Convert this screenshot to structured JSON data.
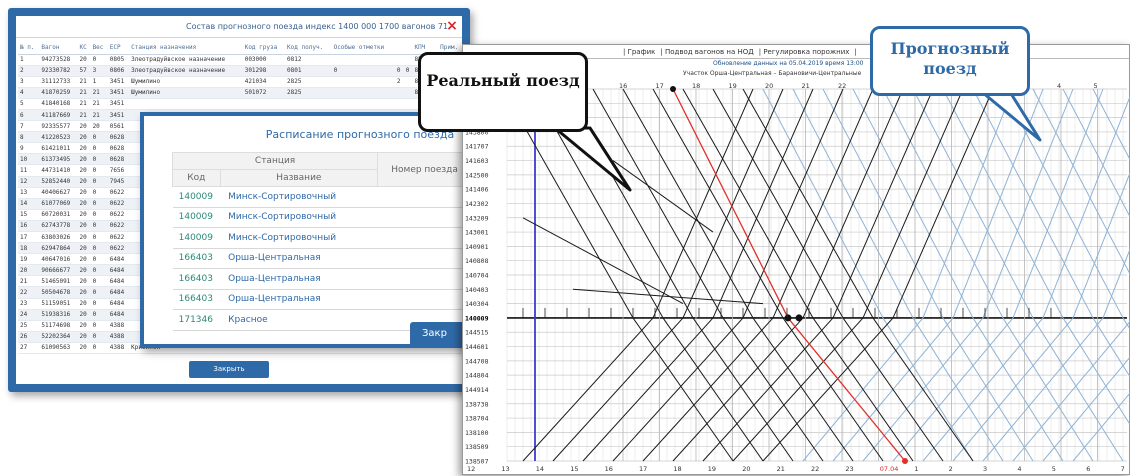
{
  "consist_window": {
    "title": "Состав прогнозного поезда индекс 1400 000 1700 вагонов 71",
    "close_label": "×",
    "columns": [
      "№ п.",
      "Вагон",
      "КС",
      "Вес",
      "ЕСР",
      "Станция назначения",
      "Код груза",
      "Код получ.",
      "Особые отметки",
      "",
      "",
      "КПЧ",
      "Прим."
    ],
    "rows": [
      [
        "1",
        "94273528",
        "20",
        "0",
        "0805",
        "Злеотрадуйвское назначение",
        "003000",
        "0812",
        "",
        "",
        "",
        "85/00",
        ""
      ],
      [
        "2",
        "92330782",
        "57",
        "3",
        "0806",
        "Злеотрадуйвское назначение",
        "301298",
        "0801",
        "0",
        "0",
        "0",
        "85/00",
        "290100"
      ],
      [
        "3",
        "31112733",
        "21",
        "1",
        "3451",
        "Шумилино",
        "421034",
        "2825",
        "",
        "2",
        "",
        "85/00",
        "ГРЕ"
      ],
      [
        "4",
        "41870259",
        "21",
        "21",
        "3451",
        "Шумилино",
        "501072",
        "2825",
        "",
        "",
        "",
        "85/00",
        "*"
      ],
      [
        "5",
        "41840168",
        "21",
        "21",
        "3451",
        "",
        "",
        "",
        "",
        "",
        "",
        "",
        ""
      ],
      [
        "6",
        "41187669",
        "21",
        "21",
        "3451",
        "",
        "",
        "",
        "",
        "",
        "",
        "",
        ""
      ],
      [
        "7",
        "92335577",
        "20",
        "20",
        "0561",
        "",
        "",
        "",
        "",
        "",
        "",
        "",
        ""
      ],
      [
        "8",
        "41220523",
        "20",
        "0",
        "0628",
        "",
        "",
        "",
        "",
        "",
        "",
        "",
        ""
      ],
      [
        "9",
        "61421011",
        "20",
        "0",
        "0628",
        "",
        "",
        "",
        "",
        "",
        "",
        "",
        ""
      ],
      [
        "10",
        "61373495",
        "20",
        "0",
        "0628",
        "",
        "",
        "",
        "",
        "",
        "",
        "",
        ""
      ],
      [
        "11",
        "44731410",
        "20",
        "0",
        "7656",
        "",
        "",
        "",
        "",
        "",
        "",
        "",
        ""
      ],
      [
        "12",
        "52852440",
        "20",
        "0",
        "7945",
        "",
        "",
        "",
        "",
        "",
        "",
        "",
        ""
      ],
      [
        "13",
        "40406627",
        "20",
        "0",
        "0622",
        "",
        "",
        "",
        "",
        "",
        "",
        "",
        ""
      ],
      [
        "14",
        "61077069",
        "20",
        "0",
        "0622",
        "",
        "",
        "",
        "",
        "",
        "",
        "",
        ""
      ],
      [
        "15",
        "60720031",
        "20",
        "0",
        "0622",
        "",
        "",
        "",
        "",
        "",
        "",
        "",
        ""
      ],
      [
        "16",
        "62743778",
        "20",
        "0",
        "0622",
        "",
        "",
        "",
        "",
        "",
        "",
        "",
        ""
      ],
      [
        "17",
        "63803026",
        "20",
        "0",
        "0622",
        "",
        "",
        "",
        "",
        "",
        "",
        "",
        ""
      ],
      [
        "18",
        "62947864",
        "20",
        "0",
        "0622",
        "",
        "",
        "",
        "",
        "",
        "",
        "",
        ""
      ],
      [
        "19",
        "40647016",
        "20",
        "0",
        "6484",
        "",
        "",
        "",
        "",
        "",
        "",
        "",
        ""
      ],
      [
        "20",
        "90666677",
        "20",
        "0",
        "6484",
        "",
        "",
        "",
        "",
        "",
        "",
        "",
        ""
      ],
      [
        "21",
        "51465091",
        "20",
        "0",
        "6484",
        "",
        "",
        "",
        "",
        "",
        "",
        "",
        ""
      ],
      [
        "22",
        "50504678",
        "20",
        "0",
        "6484",
        "",
        "",
        "",
        "",
        "",
        "",
        "",
        ""
      ],
      [
        "23",
        "51159051",
        "20",
        "0",
        "6484",
        "",
        "",
        "",
        "",
        "",
        "",
        "",
        ""
      ],
      [
        "24",
        "51938316",
        "20",
        "0",
        "6484",
        "",
        "",
        "",
        "",
        "",
        "",
        "",
        ""
      ],
      [
        "25",
        "51174698",
        "20",
        "0",
        "4388",
        "",
        "",
        "",
        "",
        "",
        "",
        "",
        ""
      ],
      [
        "26",
        "52202364",
        "20",
        "0",
        "4388",
        "",
        "",
        "",
        "",
        "",
        "",
        "",
        ""
      ],
      [
        "27",
        "61090563",
        "20",
        "0",
        "4388",
        "Кривинск",
        "",
        "",
        "",
        "",
        "",
        "",
        ""
      ]
    ],
    "close_button": "Закрыть"
  },
  "schedule_window": {
    "title": "Расписание прогнозного поезда",
    "station_header": "Станция",
    "code_header": "Код",
    "name_header": "Название",
    "train_header": "Номер поезда",
    "rows": [
      {
        "code": "140009",
        "name": "Минск-Сортировочный"
      },
      {
        "code": "140009",
        "name": "Минск-Сортировочный"
      },
      {
        "code": "140009",
        "name": "Минск-Сортировочный"
      },
      {
        "code": "166403",
        "name": "Орша-Центральная"
      },
      {
        "code": "166403",
        "name": "Орша-Центральная"
      },
      {
        "code": "166403",
        "name": "Орша-Центральная"
      },
      {
        "code": "171346",
        "name": "Красное"
      }
    ],
    "close_button": "Закр"
  },
  "graph_window": {
    "menu": [
      "| График",
      "| Подвод вагонов на НОД",
      "| Регулировка порожних",
      "|"
    ],
    "subtitle1": "Обновление данных на 05.04.2019 время 13:00",
    "subtitle2": "Участок Орша-Центральная – Барановичи-Центральные",
    "hours_top": [
      "16",
      "17",
      "18",
      "19",
      "20",
      "21",
      "22",
      "23",
      "07.04",
      "1",
      "2",
      "3",
      "4",
      "5",
      "6",
      "7"
    ],
    "hours_bottom": [
      "12",
      "13",
      "14",
      "15",
      "16",
      "17",
      "18",
      "19",
      "20",
      "21",
      "22",
      "23",
      "07.04",
      "1",
      "2",
      "3",
      "4",
      "5",
      "6",
      "7"
    ],
    "stations": [
      "147108",
      "142004",
      "141938",
      "143800",
      "141707",
      "141603",
      "142500",
      "141406",
      "142302",
      "143209",
      "143001",
      "140901",
      "140808",
      "140704",
      "140403",
      "140304",
      "140009",
      "144515",
      "144601",
      "144708",
      "144804",
      "144914",
      "138738",
      "138704",
      "138100",
      "138509",
      "138507"
    ],
    "highlight_station": "140009",
    "colors": {
      "real": "#1a1a1a",
      "forecast": "#8fb3d6",
      "highlight": "#e0302a",
      "now": "#3b3bd0",
      "grid": "#c9c9c9"
    }
  },
  "callouts": {
    "real": "Реальный поезд",
    "forecast": "Прогнозный поезд"
  }
}
